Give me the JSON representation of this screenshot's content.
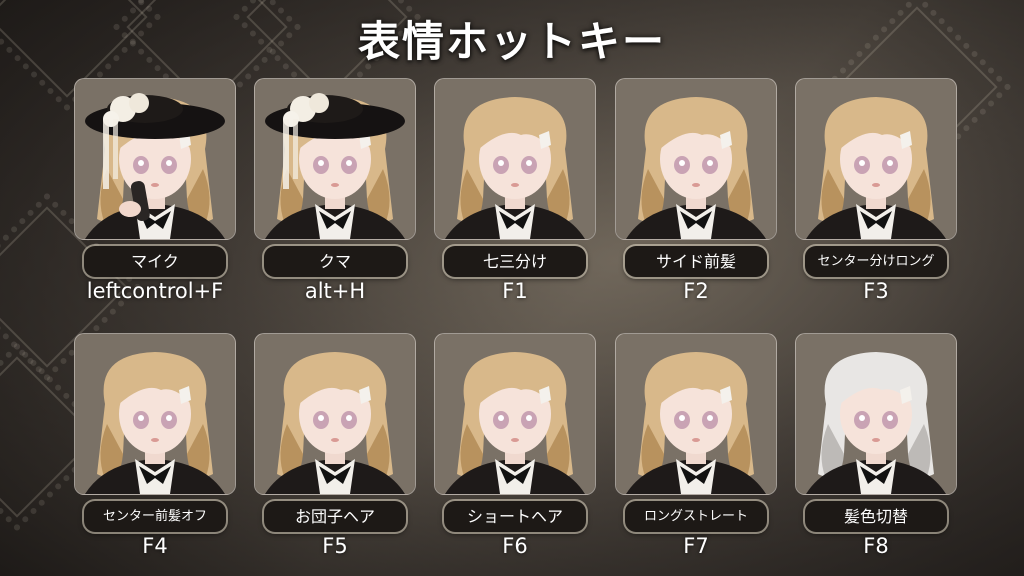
{
  "title": "表情ホットキー",
  "tiles": [
    {
      "label": "マイク",
      "key": "leftcontrol+F",
      "hair": "#d8b88a",
      "hair_dark": "#b8925e",
      "hat": true,
      "mic": true
    },
    {
      "label": "クマ",
      "key": "alt+H",
      "hair": "#d8b88a",
      "hair_dark": "#b8925e",
      "hat": true,
      "mic": false
    },
    {
      "label": "七三分け",
      "key": "F1",
      "hair": "#d8b88a",
      "hair_dark": "#b8925e",
      "hat": false,
      "mic": false
    },
    {
      "label": "サイド前髪",
      "key": "F2",
      "hair": "#d8b88a",
      "hair_dark": "#b8925e",
      "hat": false,
      "mic": false
    },
    {
      "label": "センター分けロング",
      "key": "F3",
      "hair": "#d8b88a",
      "hair_dark": "#b8925e",
      "hat": false,
      "mic": false
    },
    {
      "label": "センター前髪オフ",
      "key": "F4",
      "hair": "#d8b88a",
      "hair_dark": "#b8925e",
      "hat": false,
      "mic": false
    },
    {
      "label": "お団子ヘア",
      "key": "F5",
      "hair": "#d8b88a",
      "hair_dark": "#b8925e",
      "hat": false,
      "mic": false
    },
    {
      "label": "ショートヘア",
      "key": "F6",
      "hair": "#d8b88a",
      "hair_dark": "#b8925e",
      "hat": false,
      "mic": false
    },
    {
      "label": "ロングストレート",
      "key": "F7",
      "hair": "#d8b88a",
      "hair_dark": "#b8925e",
      "hat": false,
      "mic": false
    },
    {
      "label": "髪色切替",
      "key": "F8",
      "hair": "#e8e6e4",
      "hair_dark": "#bdbab7",
      "hat": false,
      "mic": false
    }
  ]
}
